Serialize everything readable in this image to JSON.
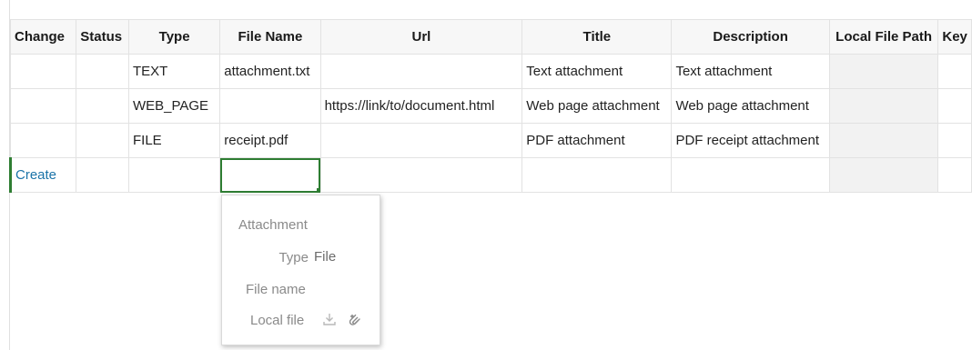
{
  "grid": {
    "headers": [
      "Change",
      "Status",
      "Type",
      "File Name",
      "Url",
      "Title",
      "Description",
      "Local File Path",
      "Key"
    ],
    "rows": [
      {
        "change": "",
        "status": "",
        "type": "TEXT",
        "file_name": "attachment.txt",
        "url": "",
        "title": "Text attachment",
        "description": "Text attachment",
        "local_file_path": "",
        "key": ""
      },
      {
        "change": "",
        "status": "",
        "type": "WEB_PAGE",
        "file_name": "",
        "url": "https://link/to/document.html",
        "title": "Web page attachment",
        "description": "Web page attachment",
        "local_file_path": "",
        "key": ""
      },
      {
        "change": "",
        "status": "",
        "type": "FILE",
        "file_name": "receipt.pdf",
        "url": "",
        "title": "PDF attachment",
        "description": "PDF receipt attachment",
        "local_file_path": "",
        "key": ""
      }
    ],
    "create_row": {
      "change": "Create",
      "status": "",
      "type": "",
      "file_name": "",
      "url": "",
      "title": "",
      "description": "",
      "local_file_path": "",
      "key": ""
    }
  },
  "popup": {
    "title": "Attachment",
    "type_label": "Type",
    "type_value": "File",
    "file_name_label": "File name",
    "local_file_label": "Local file",
    "icons": [
      "download-icon",
      "attach-file-icon"
    ]
  },
  "colors": {
    "selection": "#2e7d32",
    "create_text": "#1a73a8",
    "greyed_cell": "#f2f2f2"
  }
}
